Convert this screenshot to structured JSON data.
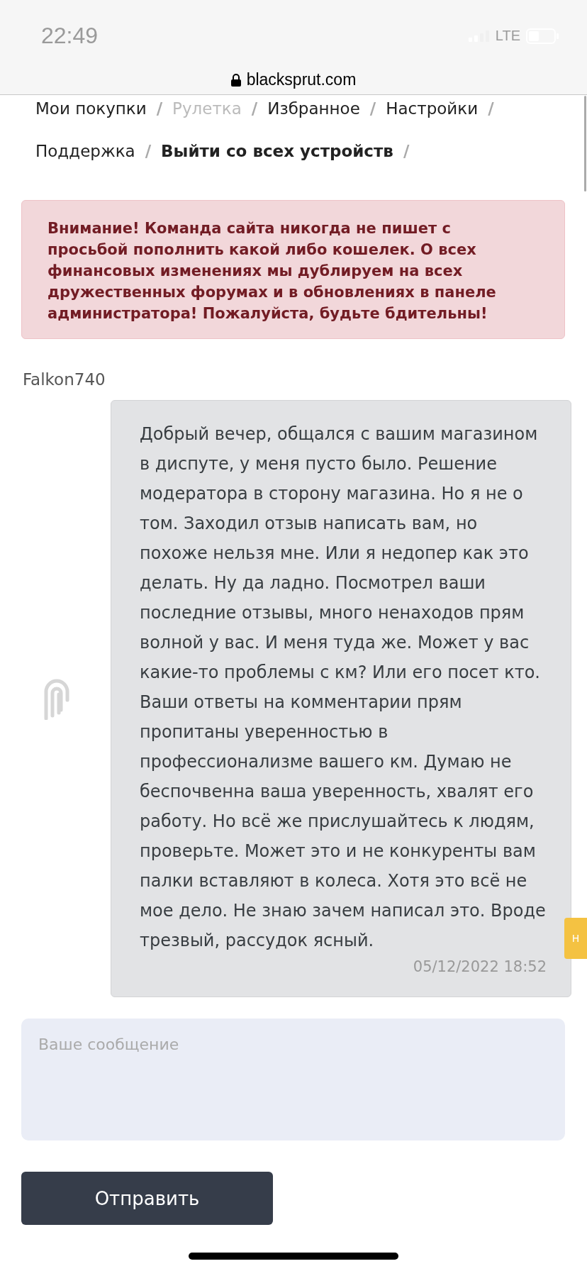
{
  "status_bar": {
    "time": "22:49",
    "network": "LTE"
  },
  "address_bar": {
    "url": "blacksprut.com"
  },
  "nav": [
    {
      "label": "Мои покупки",
      "disabled": false
    },
    {
      "label": "Рулетка",
      "disabled": true
    },
    {
      "label": "Избранное",
      "disabled": false
    },
    {
      "label": "Настройки",
      "disabled": false
    },
    {
      "label": "Поддержка",
      "disabled": false,
      "bold": false
    },
    {
      "label": "Выйти со всех устройств",
      "disabled": false,
      "bold": true
    }
  ],
  "nav_separator": "/",
  "alert": "Внимание! Команда сайта никогда не пишет с просьбой пополнить какой либо кошелек. О всех финансовых изменениях мы дублируем на всех дружественных форумах и в обновлениях в панеле администратора! Пожалуйста, будьте бдительны!",
  "message": {
    "author": "Falkon740",
    "text": "Добрый вечер, общался с вашим магазином в диспуте, у меня пусто было. Решение модератора в сторону магазина. Но я не о том. Заходил отзыв написать вам, но похоже нельзя мне. Или я недопер как это делать. Ну да ладно. Посмотрел ваши последние отзывы, много ненаходов прям волной у вас. И меня туда же. Может у вас какие-то проблемы с км? Или его посет кто. Ваши ответы на комментарии прям пропитаны уверенностью в профессионализме вашего км. Думаю не беспочвенна ваша уверенность, хвалят его работу. Но всё же прислушайтесь к людям, проверьте. Может это и не конкуренты вам палки вставляют в колеса. Хотя это всё не мое дело. Не знаю зачем написал это. Вроде трезвый, рассудок ясный.",
    "time": "05/12/2022 18:52"
  },
  "side_tab": {
    "label": "Н"
  },
  "reply": {
    "placeholder": "Ваше сообщение"
  },
  "send_button": "Отправить"
}
